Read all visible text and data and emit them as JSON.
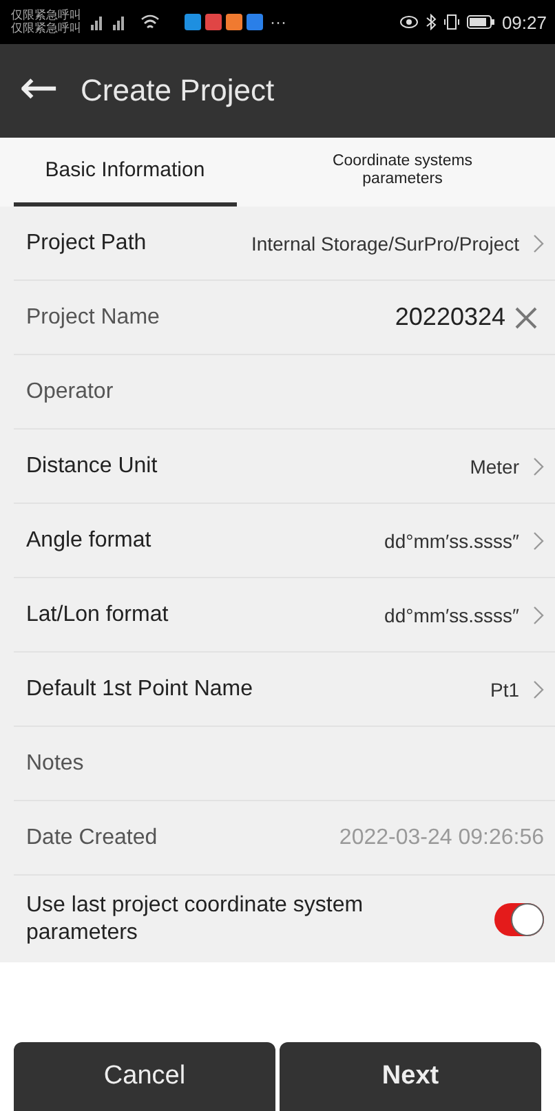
{
  "status_bar": {
    "carrier_lines": [
      "仅限紧急呼叫",
      "仅限紧急呼叫"
    ],
    "more": "···",
    "time": "09:27"
  },
  "app_bar": {
    "back": "←",
    "title": "Create Project"
  },
  "tabs": [
    {
      "label": "Basic Information",
      "selected": true
    },
    {
      "label": "Coordinate systems parameters",
      "selected": false
    }
  ],
  "rows": [
    {
      "kind": "link",
      "label": "Project Path",
      "value": "Internal Storage/SurPro/Project"
    },
    {
      "kind": "input",
      "label": "Project Name",
      "value": "20220324"
    },
    {
      "kind": "input",
      "label": "Operator"
    },
    {
      "kind": "link",
      "label": "Distance Unit",
      "value": "Meter"
    },
    {
      "kind": "link",
      "label": "Angle format",
      "value": "dd°mm′ss.ssss″"
    },
    {
      "kind": "link",
      "label": "Lat/Lon format",
      "value": "dd°mm′ss.ssss″"
    },
    {
      "kind": "link",
      "label": "Default 1st Point Name",
      "value": "Pt1"
    },
    {
      "kind": "input",
      "label": "Notes"
    },
    {
      "kind": "readonly",
      "label": "Date Created",
      "value": "2022-03-24 09:26:56"
    }
  ],
  "use_last": {
    "label": "Use last project coordinate system parameters",
    "on": true
  },
  "buttons": [
    "Cancel",
    "Next"
  ]
}
